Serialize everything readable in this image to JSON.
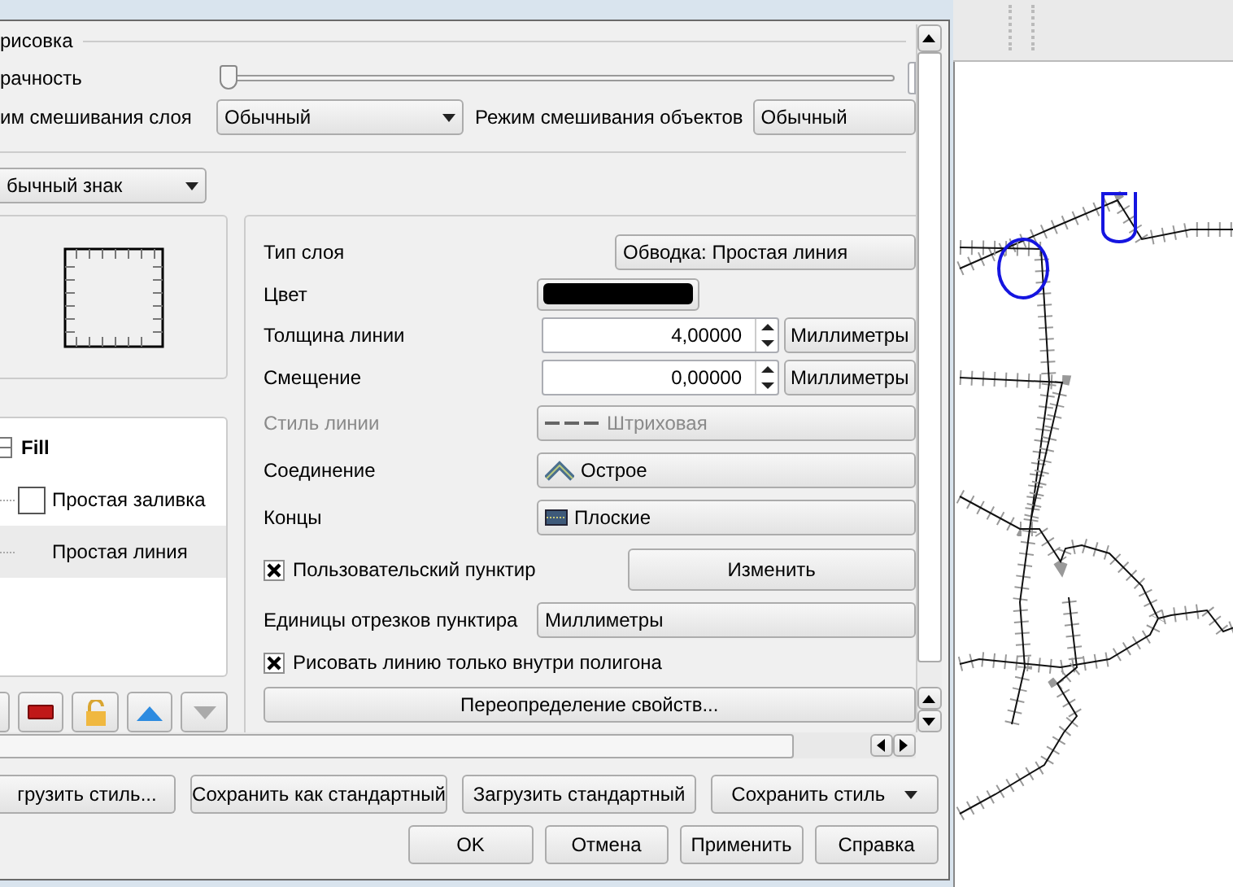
{
  "rendering": {
    "title": "рисовка",
    "transparency": {
      "label": "рачность",
      "level": 0
    },
    "layer_blend": {
      "label": "им смешивания слоя",
      "value": "Обычный"
    },
    "feature_blend": {
      "label": "Режим смешивания объектов",
      "value": "Обычный"
    }
  },
  "symbol_type": "бычный знак",
  "symbol_tree": [
    {
      "label": "Fill",
      "selected": false,
      "children": [
        {
          "label": "Простая заливка",
          "selected": false
        },
        {
          "label": "Простая линия",
          "selected": true
        }
      ]
    }
  ],
  "properties": [
    {
      "kind": "combo",
      "label": "Тип слоя",
      "value": "Обводка: Простая линия",
      "disabled": false,
      "narrow": true
    },
    {
      "kind": "color",
      "label": "Цвет",
      "color": "#000000",
      "disabled": false
    },
    {
      "kind": "spin",
      "label": "Толщина линии",
      "value": "4,00000",
      "unit": "Миллиметры",
      "disabled": false
    },
    {
      "kind": "spin",
      "label": "Смещение",
      "value": "0,00000",
      "unit": "Миллиметры",
      "disabled": false
    },
    {
      "kind": "dash-combo",
      "label": "Стиль линии",
      "value": "Штриховая",
      "disabled": true
    },
    {
      "kind": "join-combo",
      "label": "Соединение",
      "value": "Острое",
      "disabled": false
    },
    {
      "kind": "cap-combo",
      "label": "Концы",
      "value": "Плоские",
      "disabled": false
    },
    {
      "kind": "checkbox",
      "label": "Пользовательский пунктир",
      "checked": true,
      "button": "Изменить",
      "disabled": false
    },
    {
      "kind": "combo",
      "label": "Единицы отрезков пунктира",
      "value": "Миллиметры",
      "disabled": false,
      "narrow": false
    },
    {
      "kind": "checkbox",
      "label": "Рисовать линию только внутри полигона",
      "checked": true,
      "disabled": false
    }
  ],
  "override_button": "Переопределение свойств...",
  "style_buttons": [
    {
      "label": "грузить стиль...",
      "menu": false
    },
    {
      "label": "Сохранить как стандартный",
      "menu": false
    },
    {
      "label": "Загрузить стандартный",
      "menu": false
    },
    {
      "label": "Сохранить стиль",
      "menu": true
    }
  ],
  "dialog_buttons": [
    {
      "label": "OK",
      "default": true
    },
    {
      "label": "Отмена",
      "default": false
    },
    {
      "label": "Применить",
      "default": false
    },
    {
      "label": "Справка",
      "default": false
    }
  ]
}
